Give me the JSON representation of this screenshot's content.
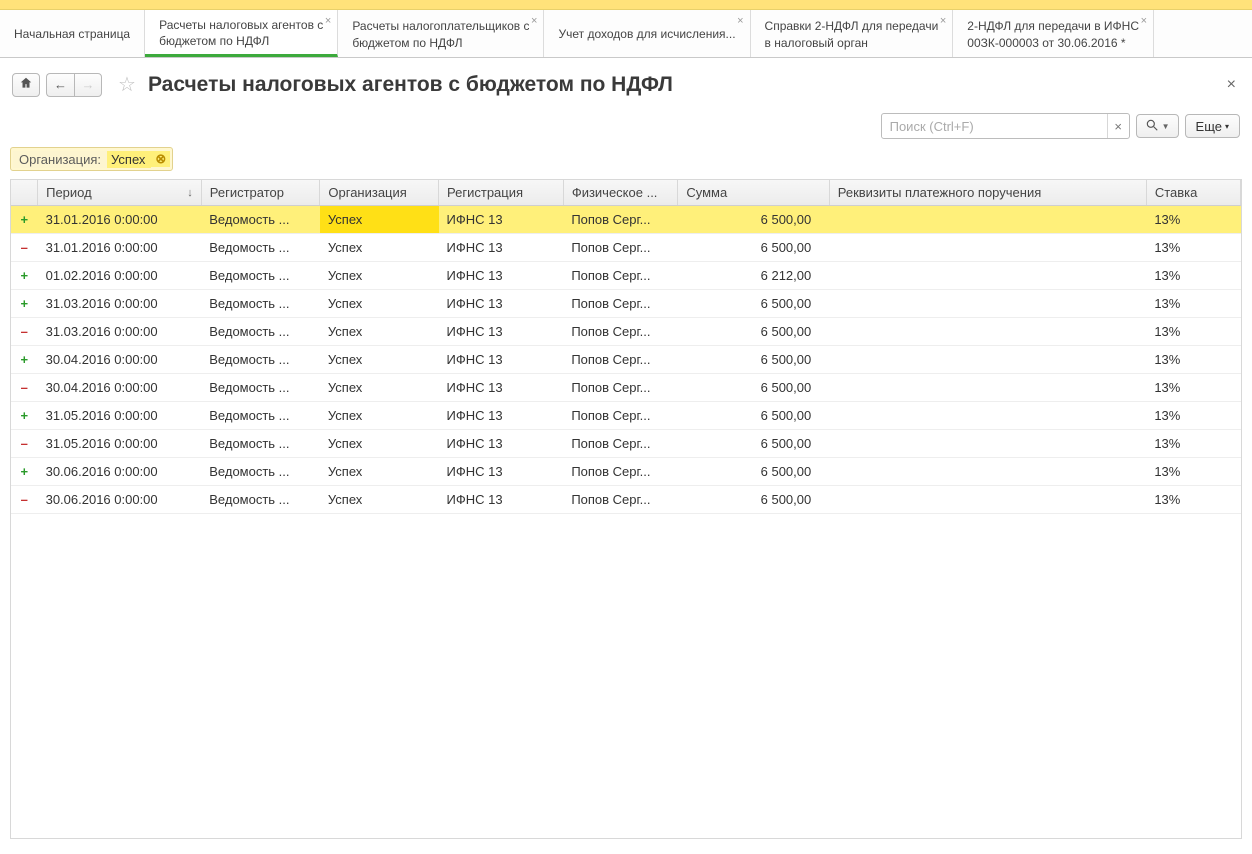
{
  "tabs": [
    {
      "label": "Начальная страница",
      "closable": false,
      "active": false
    },
    {
      "label": "Расчеты налоговых агентов с бюджетом по НДФЛ",
      "closable": true,
      "active": true
    },
    {
      "label": "Расчеты налогоплательщиков с бюджетом по НДФЛ",
      "closable": true,
      "active": false
    },
    {
      "label": "Учет доходов для исчисления...",
      "closable": true,
      "active": false
    },
    {
      "label": "Справки 2-НДФЛ для передачи в налоговый орган",
      "closable": true,
      "active": false
    },
    {
      "label": "2-НДФЛ для передачи в ИФНС 00ЗК-000003 от 30.06.2016 *",
      "closable": true,
      "active": false
    }
  ],
  "title": "Расчеты налоговых агентов с бюджетом по НДФЛ",
  "search": {
    "placeholder": "Поиск (Ctrl+F)"
  },
  "more_label": "Еще",
  "filter": {
    "label": "Организация:",
    "value": "Успех"
  },
  "columns": {
    "period": "Период",
    "registrar": "Регистратор",
    "org": "Организация",
    "reg": "Регистрация",
    "person": "Физическое ...",
    "sum": "Сумма",
    "reqs": "Реквизиты платежного поручения",
    "rate": "Ставка"
  },
  "rows": [
    {
      "sign": "+",
      "period": "31.01.2016 0:00:00",
      "registrar": "Ведомость ...",
      "org": "Успех",
      "reg": "ИФНС 13",
      "person": "Попов Серг...",
      "sum": "6 500,00",
      "reqs": "",
      "rate": "13%",
      "selected": true
    },
    {
      "sign": "-",
      "period": "31.01.2016 0:00:00",
      "registrar": "Ведомость ...",
      "org": "Успех",
      "reg": "ИФНС 13",
      "person": "Попов Серг...",
      "sum": "6 500,00",
      "reqs": "",
      "rate": "13%"
    },
    {
      "sign": "+",
      "period": "01.02.2016 0:00:00",
      "registrar": "Ведомость ...",
      "org": "Успех",
      "reg": "ИФНС 13",
      "person": "Попов Серг...",
      "sum": "6 212,00",
      "reqs": "",
      "rate": "13%"
    },
    {
      "sign": "+",
      "period": "31.03.2016 0:00:00",
      "registrar": "Ведомость ...",
      "org": "Успех",
      "reg": "ИФНС 13",
      "person": "Попов Серг...",
      "sum": "6 500,00",
      "reqs": "",
      "rate": "13%"
    },
    {
      "sign": "-",
      "period": "31.03.2016 0:00:00",
      "registrar": "Ведомость ...",
      "org": "Успех",
      "reg": "ИФНС 13",
      "person": "Попов Серг...",
      "sum": "6 500,00",
      "reqs": "",
      "rate": "13%"
    },
    {
      "sign": "+",
      "period": "30.04.2016 0:00:00",
      "registrar": "Ведомость ...",
      "org": "Успех",
      "reg": "ИФНС 13",
      "person": "Попов Серг...",
      "sum": "6 500,00",
      "reqs": "",
      "rate": "13%"
    },
    {
      "sign": "-",
      "period": "30.04.2016 0:00:00",
      "registrar": "Ведомость ...",
      "org": "Успех",
      "reg": "ИФНС 13",
      "person": "Попов Серг...",
      "sum": "6 500,00",
      "reqs": "",
      "rate": "13%"
    },
    {
      "sign": "+",
      "period": "31.05.2016 0:00:00",
      "registrar": "Ведомость ...",
      "org": "Успех",
      "reg": "ИФНС 13",
      "person": "Попов Серг...",
      "sum": "6 500,00",
      "reqs": "",
      "rate": "13%"
    },
    {
      "sign": "-",
      "period": "31.05.2016 0:00:00",
      "registrar": "Ведомость ...",
      "org": "Успех",
      "reg": "ИФНС 13",
      "person": "Попов Серг...",
      "sum": "6 500,00",
      "reqs": "",
      "rate": "13%"
    },
    {
      "sign": "+",
      "period": "30.06.2016 0:00:00",
      "registrar": "Ведомость ...",
      "org": "Успех",
      "reg": "ИФНС 13",
      "person": "Попов Серг...",
      "sum": "6 500,00",
      "reqs": "",
      "rate": "13%"
    },
    {
      "sign": "-",
      "period": "30.06.2016 0:00:00",
      "registrar": "Ведомость ...",
      "org": "Успех",
      "reg": "ИФНС 13",
      "person": "Попов Серг...",
      "sum": "6 500,00",
      "reqs": "",
      "rate": "13%"
    }
  ]
}
